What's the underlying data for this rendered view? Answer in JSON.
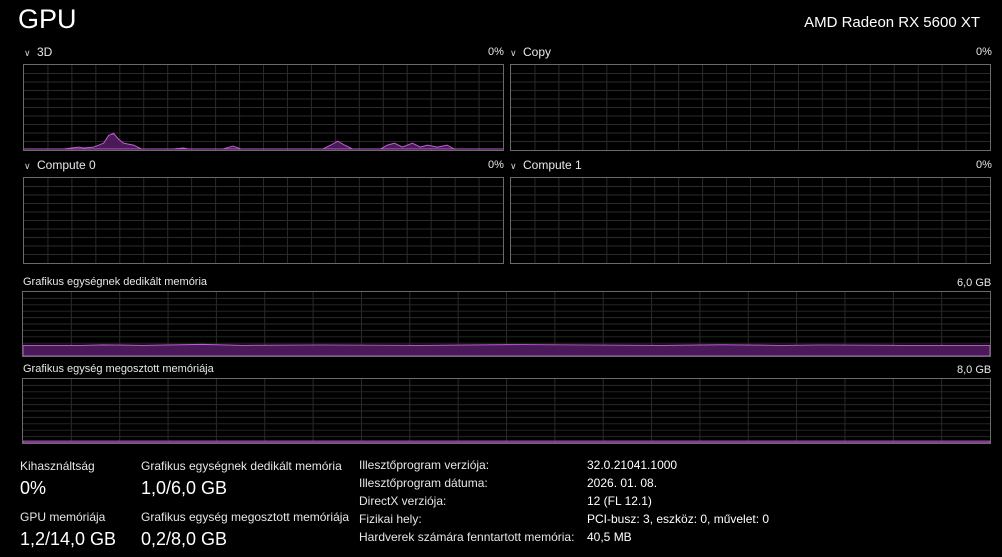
{
  "header": {
    "title": "GPU",
    "device": "AMD Radeon RX 5600 XT"
  },
  "engines": [
    {
      "name": "3D",
      "percent": "0%"
    },
    {
      "name": "Copy",
      "percent": "0%"
    },
    {
      "name": "Compute 0",
      "percent": "0%"
    },
    {
      "name": "Compute 1",
      "percent": "0%"
    }
  ],
  "memory_graphs": [
    {
      "name": "Grafikus egységnek dedikált memória",
      "max": "6,0 GB"
    },
    {
      "name": "Grafikus egység megosztott memóriája",
      "max": "8,0 GB"
    }
  ],
  "stats": {
    "usage": {
      "label": "Kihasználtság",
      "value": "0%"
    },
    "dedicated": {
      "label": "Grafikus egységnek dedikált memória",
      "value": "1,0/6,0 GB"
    },
    "gpu_memory": {
      "label": "GPU memóriája",
      "value": "1,2/14,0 GB"
    },
    "shared": {
      "label": "Grafikus egység megosztott memóriája",
      "value": "0,2/8,0 GB"
    }
  },
  "info": [
    {
      "label": "Illesztőprogram verziója:",
      "value": "32.0.21041.1000"
    },
    {
      "label": "Illesztőprogram dátuma:",
      "value": "2026. 01. 08."
    },
    {
      "label": "DirectX verziója:",
      "value": "12 (FL 12.1)"
    },
    {
      "label": "Fizikai hely:",
      "value": "PCI-busz: 3, eszköz: 0, művelet: 0"
    },
    {
      "label": "Hardverek számára fenntartott memória:",
      "value": "40,5 MB"
    }
  ],
  "colors": {
    "accent": "#c060d0",
    "fill": "#4a1a58",
    "grid": "#2a2a2a",
    "border": "#6a6a6a"
  }
}
